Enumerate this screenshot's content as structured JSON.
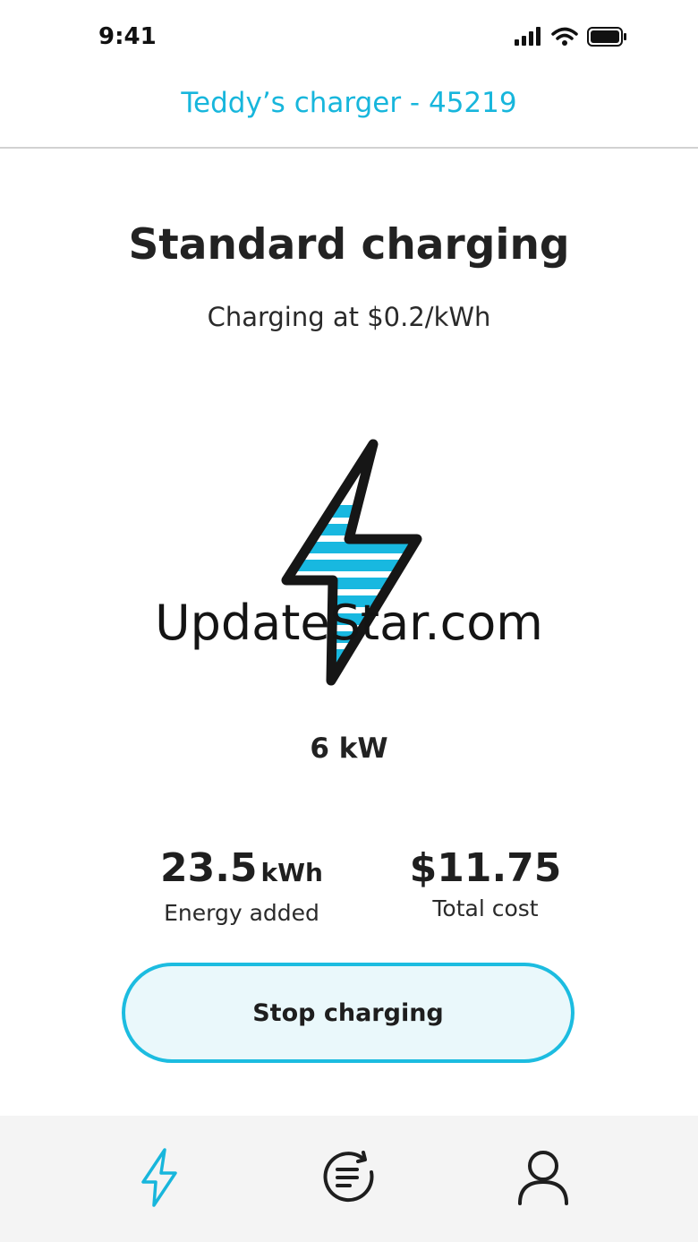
{
  "status_bar": {
    "time": "9:41"
  },
  "header": {
    "title": "Teddy’s charger - 45219"
  },
  "main": {
    "title": "Standard charging",
    "subtitle": "Charging at $0.2/kWh",
    "watermark": "UpdateStar.com",
    "power": "6 kW",
    "bolt_icon": "lightning-bolt-icon"
  },
  "stats": {
    "energy": {
      "value": "23.5",
      "unit": "kWh",
      "label": "Energy added"
    },
    "cost": {
      "value": "$11.75",
      "label": "Total cost"
    }
  },
  "actions": {
    "stop_label": "Stop charging"
  },
  "tab_bar": {
    "tabs": [
      {
        "icon": "lightning-icon",
        "active": true
      },
      {
        "icon": "history-icon",
        "active": false
      },
      {
        "icon": "profile-icon",
        "active": false
      }
    ]
  },
  "colors": {
    "accent": "#17b6dc",
    "button_bg": "#eaf8fb",
    "tab_bar_bg": "#f4f4f4",
    "text": "#1e1e1e"
  }
}
